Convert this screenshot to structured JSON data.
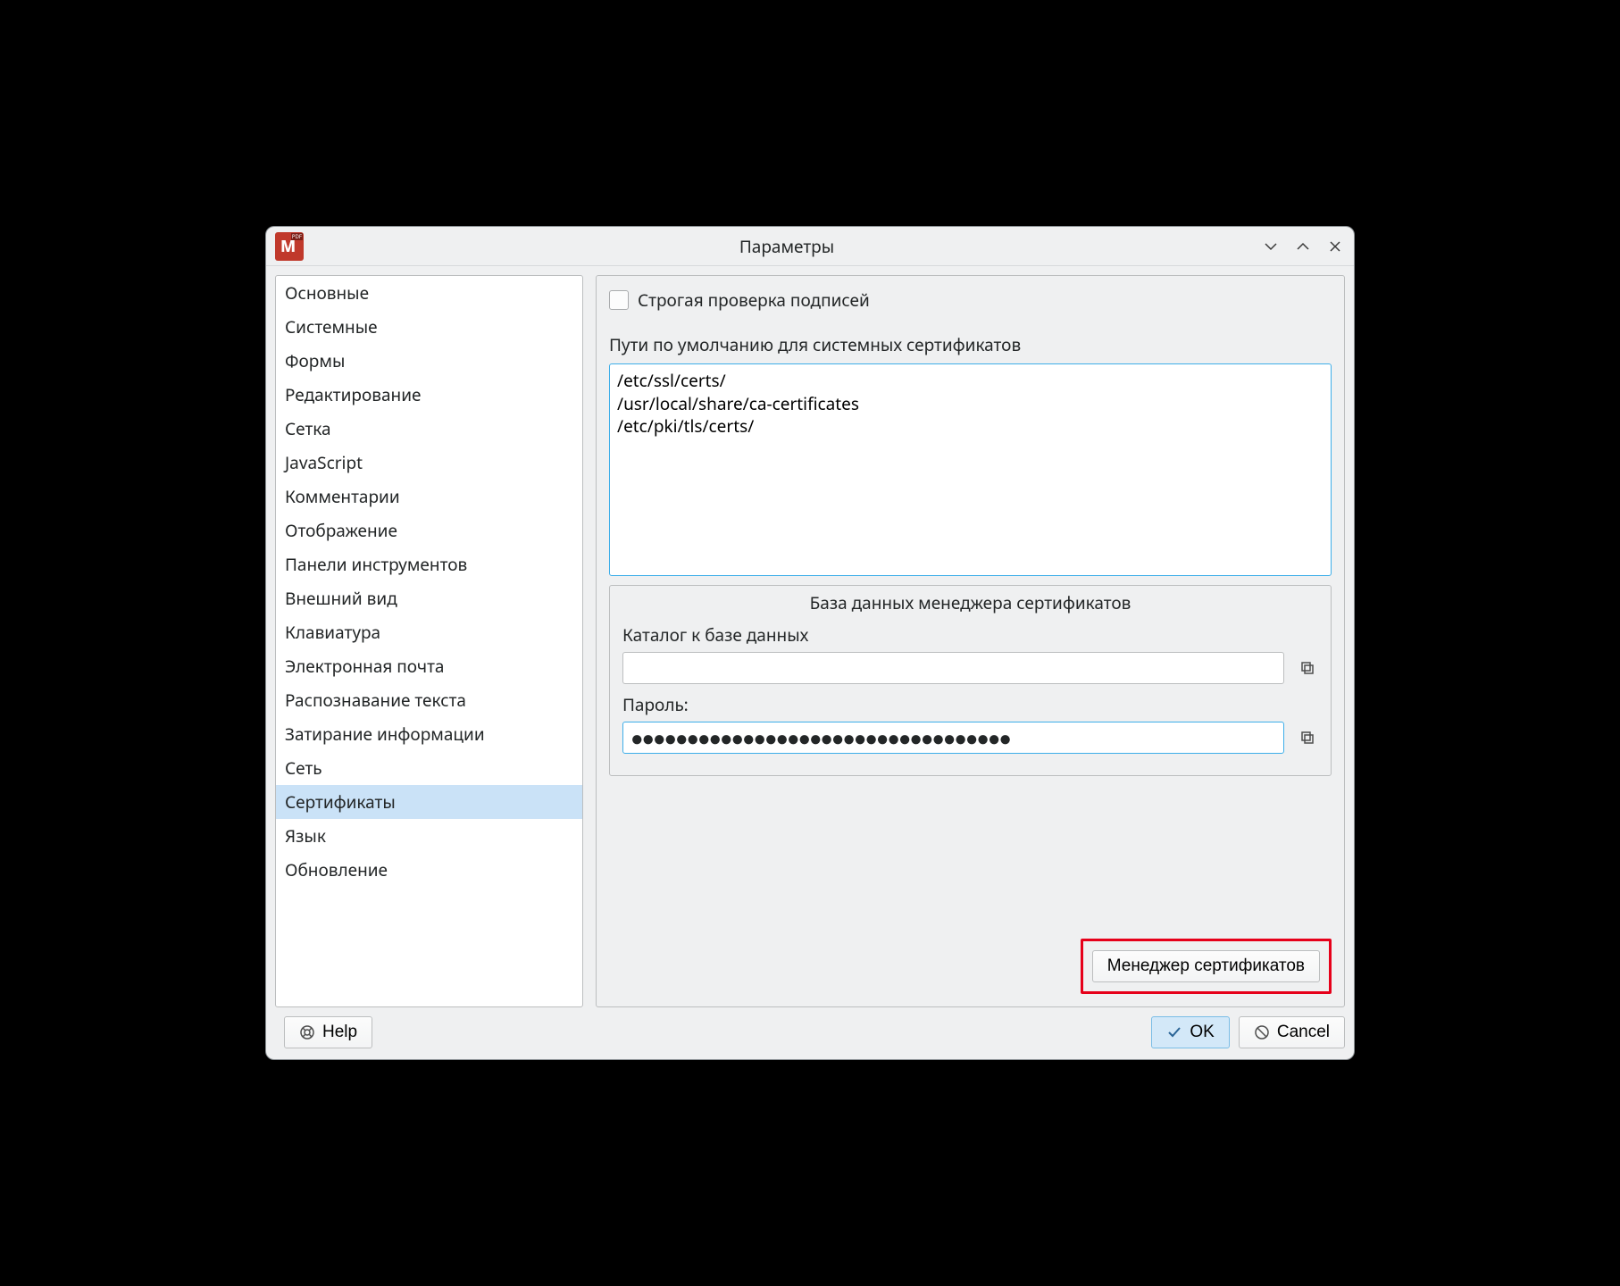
{
  "window": {
    "title": "Параметры"
  },
  "sidebar": {
    "items": [
      {
        "label": "Основные"
      },
      {
        "label": "Системные"
      },
      {
        "label": "Формы"
      },
      {
        "label": "Редактирование"
      },
      {
        "label": "Сетка"
      },
      {
        "label": "JavaScript"
      },
      {
        "label": "Комментарии"
      },
      {
        "label": "Отображение"
      },
      {
        "label": "Панели инструментов"
      },
      {
        "label": "Внешний вид"
      },
      {
        "label": "Клавиатура"
      },
      {
        "label": "Электронная почта"
      },
      {
        "label": "Распознавание текста"
      },
      {
        "label": "Затирание информации"
      },
      {
        "label": "Сеть"
      },
      {
        "label": "Сертификаты"
      },
      {
        "label": "Язык"
      },
      {
        "label": "Обновление"
      }
    ],
    "selected_index": 15
  },
  "content": {
    "strict_check_label": "Строгая проверка подписей",
    "strict_check_checked": false,
    "paths_label": "Пути по умолчанию для системных сертификатов",
    "paths_value": "/etc/ssl/certs/\n/usr/local/share/ca-certificates\n/etc/pki/tls/certs/",
    "db_group_title": "База данных менеджера сертификатов",
    "db_dir_label": "Каталог к базе данных",
    "db_dir_value": "",
    "password_label": "Пароль:",
    "password_mask": "●●●●●●●●●●●●●●●●●●●●●●●●●●●●●●●●●●",
    "cert_manager_button": "Менеджер сертификатов"
  },
  "footer": {
    "help": "Help",
    "ok": "OK",
    "cancel": "Cancel"
  }
}
